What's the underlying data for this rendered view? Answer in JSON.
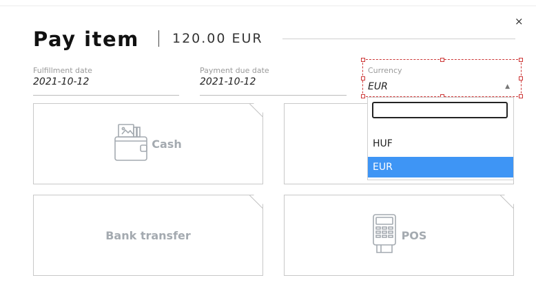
{
  "dialog": {
    "title": "Pay item",
    "amount": "120.00 EUR",
    "close_glyph": "×"
  },
  "fields": {
    "fulfillment": {
      "label": "Fulfillment date",
      "value": "2021-10-12"
    },
    "due": {
      "label": "Payment due date",
      "value": "2021-10-12"
    },
    "currency": {
      "label": "Currency",
      "value": "EUR",
      "caret": "▲"
    }
  },
  "dropdown": {
    "search_value": "",
    "options": [
      "HUF",
      "EUR"
    ],
    "selected_index": 1
  },
  "methods": [
    {
      "label": "Cash",
      "icon": "wallet-icon"
    },
    {
      "label": "",
      "icon": ""
    },
    {
      "label": "Bank transfer",
      "icon": ""
    },
    {
      "label": "POS",
      "icon": "pos-terminal-icon"
    }
  ],
  "colors": {
    "selected_option": "#3e95f5",
    "selection_outline": "#cc3333",
    "card_text": "#a4aab0"
  }
}
